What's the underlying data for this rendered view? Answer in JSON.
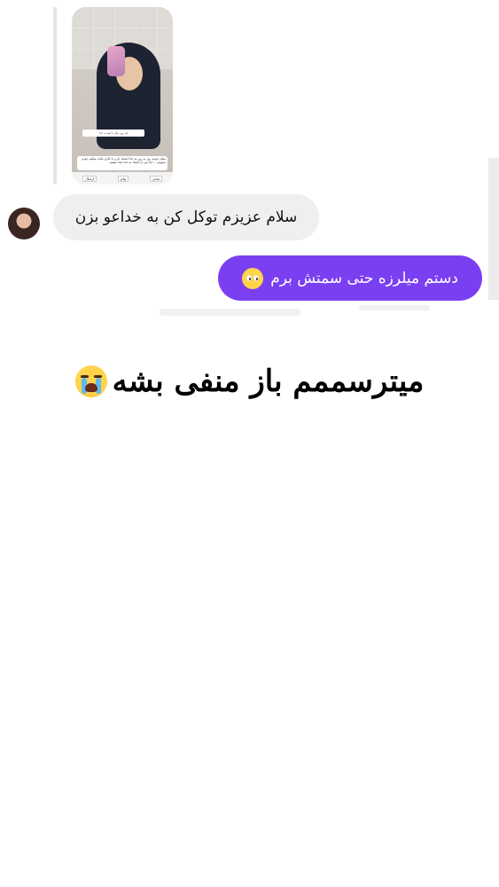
{
  "chat": {
    "story_reply": {
      "caption": "سلام خوبید روز به روز به خدا اعتماد دارم یا تکرار فکت میکنم خودم نمیتونم ... اما من از اعتماد به خدا شاد میشم",
      "note": "یک روز دیگر با امید به خدا",
      "buttons": [
        "ارسال",
        "پیام",
        "بعدی"
      ]
    },
    "incoming_message": "سلام عزیزم توکل کن به خداعو بزن",
    "outgoing_message": "دستم میلرزه حتی سمتش برم",
    "outgoing_emoji": "pleading-face"
  },
  "caption": {
    "text": "میترسممم باز منفی بشه",
    "emoji": "loudly-crying-face"
  },
  "colors": {
    "outgoing_bubble": "#7b3ff2",
    "incoming_bubble": "#efeff1",
    "background": "#ffffff"
  }
}
